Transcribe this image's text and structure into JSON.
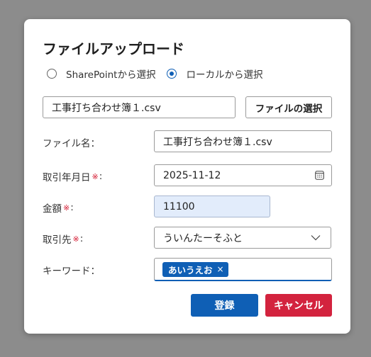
{
  "dialog": {
    "title": "ファイルアップロード",
    "source_options": [
      {
        "label": "SharePointから選択",
        "selected": false
      },
      {
        "label": "ローカルから選択",
        "selected": true
      }
    ],
    "file_box_value": "工事打ち合わせ簿１.csv",
    "file_select_label": "ファイルの選択",
    "required_mark": "※",
    "fields": {
      "filename": {
        "label": "ファイル名",
        "colon": "：",
        "value": "工事打ち合わせ簿１.csv"
      },
      "date": {
        "label": "取引年月日",
        "colon": ":",
        "value": "2025-11-12",
        "icon": "calendar-icon"
      },
      "amount": {
        "label": "金額",
        "colon": ":",
        "value": "11100"
      },
      "client": {
        "label": "取引先",
        "colon": ":",
        "value": "ういんたーそふと",
        "icon": "chevron-down-icon"
      },
      "keyword": {
        "label": "キーワード",
        "colon": "：",
        "tags": [
          "あいうえお"
        ],
        "remove_glyph": "×"
      }
    },
    "buttons": {
      "register": "登録",
      "cancel": "キャンセル"
    },
    "colors": {
      "primary": "#0f5fb5",
      "danger": "#d3233e",
      "required": "#d3132b",
      "amount_bg": "#e2ecfb"
    }
  }
}
